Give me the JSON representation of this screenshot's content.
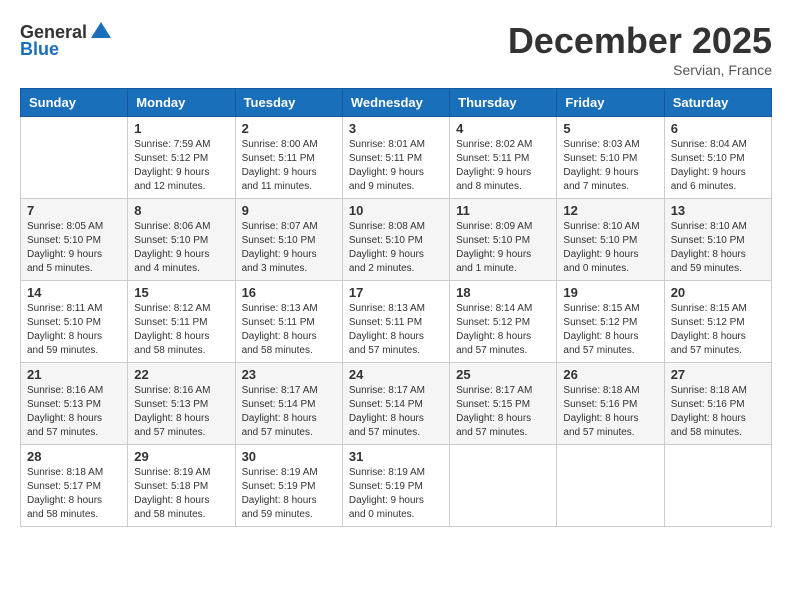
{
  "header": {
    "logo_general": "General",
    "logo_blue": "Blue",
    "month_title": "December 2025",
    "subtitle": "Servian, France"
  },
  "days_of_week": [
    "Sunday",
    "Monday",
    "Tuesday",
    "Wednesday",
    "Thursday",
    "Friday",
    "Saturday"
  ],
  "weeks": [
    [
      {
        "day": "",
        "info": ""
      },
      {
        "day": "1",
        "info": "Sunrise: 7:59 AM\nSunset: 5:12 PM\nDaylight: 9 hours\nand 12 minutes."
      },
      {
        "day": "2",
        "info": "Sunrise: 8:00 AM\nSunset: 5:11 PM\nDaylight: 9 hours\nand 11 minutes."
      },
      {
        "day": "3",
        "info": "Sunrise: 8:01 AM\nSunset: 5:11 PM\nDaylight: 9 hours\nand 9 minutes."
      },
      {
        "day": "4",
        "info": "Sunrise: 8:02 AM\nSunset: 5:11 PM\nDaylight: 9 hours\nand 8 minutes."
      },
      {
        "day": "5",
        "info": "Sunrise: 8:03 AM\nSunset: 5:10 PM\nDaylight: 9 hours\nand 7 minutes."
      },
      {
        "day": "6",
        "info": "Sunrise: 8:04 AM\nSunset: 5:10 PM\nDaylight: 9 hours\nand 6 minutes."
      }
    ],
    [
      {
        "day": "7",
        "info": "Sunrise: 8:05 AM\nSunset: 5:10 PM\nDaylight: 9 hours\nand 5 minutes."
      },
      {
        "day": "8",
        "info": "Sunrise: 8:06 AM\nSunset: 5:10 PM\nDaylight: 9 hours\nand 4 minutes."
      },
      {
        "day": "9",
        "info": "Sunrise: 8:07 AM\nSunset: 5:10 PM\nDaylight: 9 hours\nand 3 minutes."
      },
      {
        "day": "10",
        "info": "Sunrise: 8:08 AM\nSunset: 5:10 PM\nDaylight: 9 hours\nand 2 minutes."
      },
      {
        "day": "11",
        "info": "Sunrise: 8:09 AM\nSunset: 5:10 PM\nDaylight: 9 hours\nand 1 minute."
      },
      {
        "day": "12",
        "info": "Sunrise: 8:10 AM\nSunset: 5:10 PM\nDaylight: 9 hours\nand 0 minutes."
      },
      {
        "day": "13",
        "info": "Sunrise: 8:10 AM\nSunset: 5:10 PM\nDaylight: 8 hours\nand 59 minutes."
      }
    ],
    [
      {
        "day": "14",
        "info": "Sunrise: 8:11 AM\nSunset: 5:10 PM\nDaylight: 8 hours\nand 59 minutes."
      },
      {
        "day": "15",
        "info": "Sunrise: 8:12 AM\nSunset: 5:11 PM\nDaylight: 8 hours\nand 58 minutes."
      },
      {
        "day": "16",
        "info": "Sunrise: 8:13 AM\nSunset: 5:11 PM\nDaylight: 8 hours\nand 58 minutes."
      },
      {
        "day": "17",
        "info": "Sunrise: 8:13 AM\nSunset: 5:11 PM\nDaylight: 8 hours\nand 57 minutes."
      },
      {
        "day": "18",
        "info": "Sunrise: 8:14 AM\nSunset: 5:12 PM\nDaylight: 8 hours\nand 57 minutes."
      },
      {
        "day": "19",
        "info": "Sunrise: 8:15 AM\nSunset: 5:12 PM\nDaylight: 8 hours\nand 57 minutes."
      },
      {
        "day": "20",
        "info": "Sunrise: 8:15 AM\nSunset: 5:12 PM\nDaylight: 8 hours\nand 57 minutes."
      }
    ],
    [
      {
        "day": "21",
        "info": "Sunrise: 8:16 AM\nSunset: 5:13 PM\nDaylight: 8 hours\nand 57 minutes."
      },
      {
        "day": "22",
        "info": "Sunrise: 8:16 AM\nSunset: 5:13 PM\nDaylight: 8 hours\nand 57 minutes."
      },
      {
        "day": "23",
        "info": "Sunrise: 8:17 AM\nSunset: 5:14 PM\nDaylight: 8 hours\nand 57 minutes."
      },
      {
        "day": "24",
        "info": "Sunrise: 8:17 AM\nSunset: 5:14 PM\nDaylight: 8 hours\nand 57 minutes."
      },
      {
        "day": "25",
        "info": "Sunrise: 8:17 AM\nSunset: 5:15 PM\nDaylight: 8 hours\nand 57 minutes."
      },
      {
        "day": "26",
        "info": "Sunrise: 8:18 AM\nSunset: 5:16 PM\nDaylight: 8 hours\nand 57 minutes."
      },
      {
        "day": "27",
        "info": "Sunrise: 8:18 AM\nSunset: 5:16 PM\nDaylight: 8 hours\nand 58 minutes."
      }
    ],
    [
      {
        "day": "28",
        "info": "Sunrise: 8:18 AM\nSunset: 5:17 PM\nDaylight: 8 hours\nand 58 minutes."
      },
      {
        "day": "29",
        "info": "Sunrise: 8:19 AM\nSunset: 5:18 PM\nDaylight: 8 hours\nand 58 minutes."
      },
      {
        "day": "30",
        "info": "Sunrise: 8:19 AM\nSunset: 5:19 PM\nDaylight: 8 hours\nand 59 minutes."
      },
      {
        "day": "31",
        "info": "Sunrise: 8:19 AM\nSunset: 5:19 PM\nDaylight: 9 hours\nand 0 minutes."
      },
      {
        "day": "",
        "info": ""
      },
      {
        "day": "",
        "info": ""
      },
      {
        "day": "",
        "info": ""
      }
    ]
  ]
}
